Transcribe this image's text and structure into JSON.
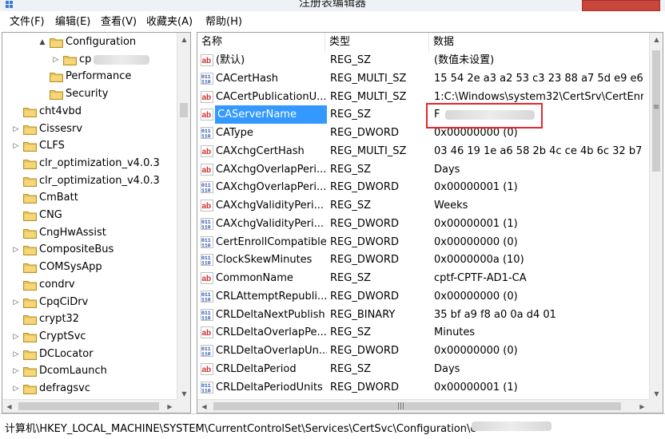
{
  "window": {
    "title": "注册表编辑器"
  },
  "menu": [
    "文件(F)",
    "编辑(E)",
    "查看(V)",
    "收藏夹(A)",
    "帮助(H)"
  ],
  "tree": [
    {
      "label": "Configuration",
      "indent": 3,
      "expander": "▲"
    },
    {
      "label": "cp",
      "indent": 4,
      "expander": "▷"
    },
    {
      "label": "Performance",
      "indent": 3,
      "expander": ""
    },
    {
      "label": "Security",
      "indent": 3,
      "expander": ""
    },
    {
      "label": "cht4vbd",
      "indent": 2,
      "expander": ""
    },
    {
      "label": "Cissesrv",
      "indent": 2,
      "expander": "▷"
    },
    {
      "label": "CLFS",
      "indent": 2,
      "expander": "▷"
    },
    {
      "label": "clr_optimization_v4.0.3",
      "indent": 2,
      "expander": ""
    },
    {
      "label": "clr_optimization_v4.0.3",
      "indent": 2,
      "expander": ""
    },
    {
      "label": "CmBatt",
      "indent": 2,
      "expander": ""
    },
    {
      "label": "CNG",
      "indent": 2,
      "expander": ""
    },
    {
      "label": "CngHwAssist",
      "indent": 2,
      "expander": ""
    },
    {
      "label": "CompositeBus",
      "indent": 2,
      "expander": "▷"
    },
    {
      "label": "COMSysApp",
      "indent": 2,
      "expander": ""
    },
    {
      "label": "condrv",
      "indent": 2,
      "expander": ""
    },
    {
      "label": "CpqCiDrv",
      "indent": 2,
      "expander": "▷"
    },
    {
      "label": "crypt32",
      "indent": 2,
      "expander": ""
    },
    {
      "label": "CryptSvc",
      "indent": 2,
      "expander": "▷"
    },
    {
      "label": "DCLocator",
      "indent": 2,
      "expander": "▷"
    },
    {
      "label": "DcomLaunch",
      "indent": 2,
      "expander": "▷"
    },
    {
      "label": "defragsvc",
      "indent": 2,
      "expander": "▷"
    }
  ],
  "columns": {
    "name": "名称",
    "type": "类型",
    "data": "数据"
  },
  "values": [
    {
      "icon": "ab",
      "name": "(默认)",
      "type": "REG_SZ",
      "data": "(数值未设置)"
    },
    {
      "icon": "bin",
      "name": "CACertHash",
      "type": "REG_MULTI_SZ",
      "data": "15 54 2e a3 a2 53 c3 23 88 a7 5d e9 e6 0"
    },
    {
      "icon": "ab",
      "name": "CACertPublicationU...",
      "type": "REG_MULTI_SZ",
      "data": "1:C:\\Windows\\system32\\CertSrv\\CertEnro"
    },
    {
      "icon": "ab",
      "name": "CAServerName",
      "type": "REG_SZ",
      "data": "F"
    },
    {
      "icon": "bin",
      "name": "CAType",
      "type": "REG_DWORD",
      "data": "0x00000000 (0)"
    },
    {
      "icon": "ab",
      "name": "CAXchgCertHash",
      "type": "REG_MULTI_SZ",
      "data": "03 46 19 1e a6 58 2b 4c ce 4b 6c 32 b7 c"
    },
    {
      "icon": "ab",
      "name": "CAXchgOverlapPeri...",
      "type": "REG_SZ",
      "data": "Days"
    },
    {
      "icon": "bin",
      "name": "CAXchgOverlapPeri...",
      "type": "REG_DWORD",
      "data": "0x00000001 (1)"
    },
    {
      "icon": "ab",
      "name": "CAXchgValidityPeri...",
      "type": "REG_SZ",
      "data": "Weeks"
    },
    {
      "icon": "bin",
      "name": "CAXchgValidityPeri...",
      "type": "REG_DWORD",
      "data": "0x00000001 (1)"
    },
    {
      "icon": "bin",
      "name": "CertEnrollCompatible",
      "type": "REG_DWORD",
      "data": "0x00000000 (0)"
    },
    {
      "icon": "bin",
      "name": "ClockSkewMinutes",
      "type": "REG_DWORD",
      "data": "0x0000000a (10)"
    },
    {
      "icon": "ab",
      "name": "CommonName",
      "type": "REG_SZ",
      "data": "cptf-CPTF-AD1-CA"
    },
    {
      "icon": "bin",
      "name": "CRLAttemptRepubli...",
      "type": "REG_DWORD",
      "data": "0x00000000 (0)"
    },
    {
      "icon": "bin",
      "name": "CRLDeltaNextPublish",
      "type": "REG_BINARY",
      "data": "35 bf a9 f8 a0 0a d4 01"
    },
    {
      "icon": "ab",
      "name": "CRLDeltaOverlapPe...",
      "type": "REG_SZ",
      "data": "Minutes"
    },
    {
      "icon": "bin",
      "name": "CRLDeltaOverlapUn...",
      "type": "REG_DWORD",
      "data": "0x00000000 (0)"
    },
    {
      "icon": "ab",
      "name": "CRLDeltaPeriod",
      "type": "REG_SZ",
      "data": "Days"
    },
    {
      "icon": "bin",
      "name": "CRLDeltaPeriodUnits",
      "type": "REG_DWORD",
      "data": "0x00000001 (1)"
    }
  ],
  "selected_value_index": 3,
  "status": {
    "path": "计算机\\HKEY_LOCAL_MACHINE\\SYSTEM\\CurrentControlSet\\Services\\CertSvc\\Configuration\\c"
  },
  "colors": {
    "selection": "#3399ff",
    "highlight_box": "#e8262a",
    "folder": "#e8c25a"
  }
}
